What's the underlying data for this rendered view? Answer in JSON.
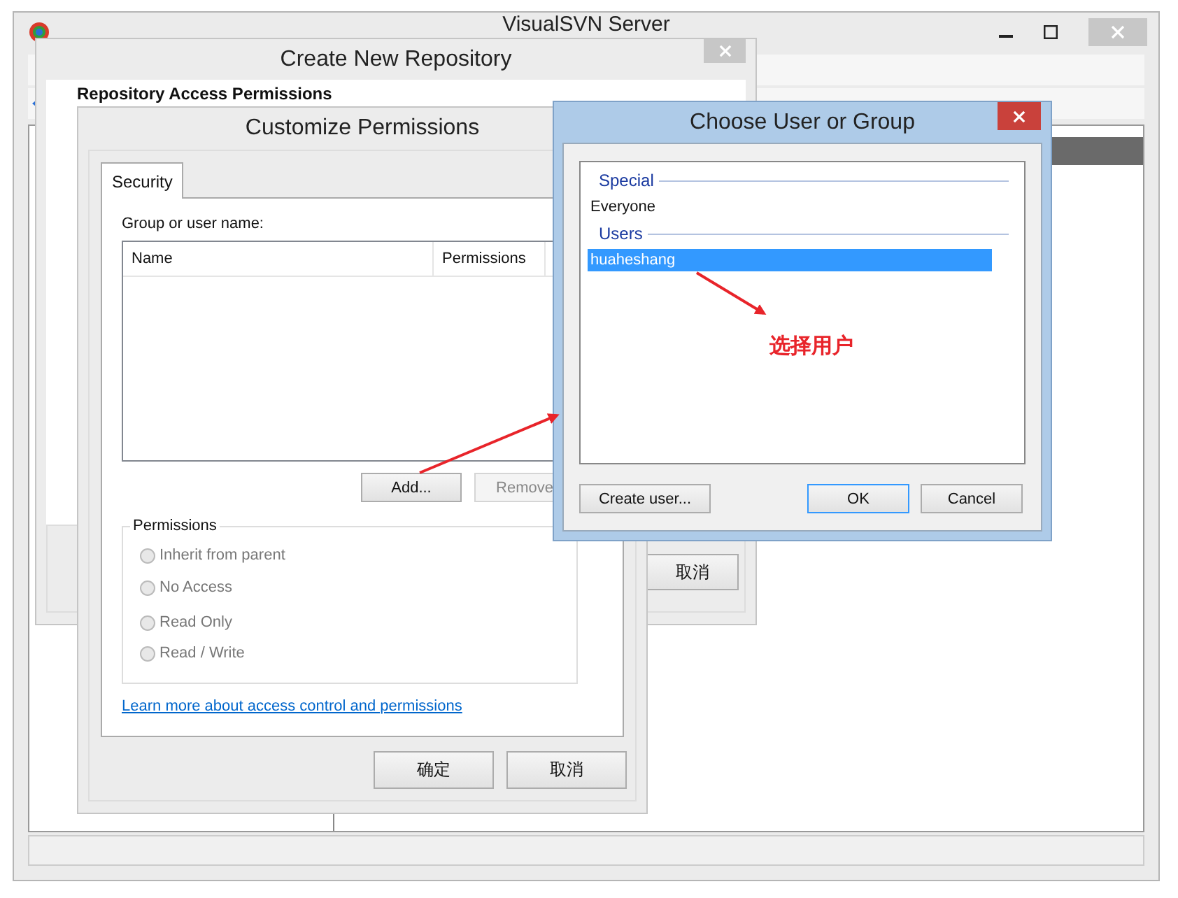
{
  "main_window": {
    "title": "VisualSVN Server"
  },
  "create_dialog": {
    "title": "Create New Repository",
    "heading": "Repository Access Permissions",
    "buttons": [
      "取消"
    ]
  },
  "permissions_dialog": {
    "title": "Customize Permissions",
    "tabs": [
      {
        "label": "Security",
        "selected": true
      }
    ],
    "list_label": "Group or user name:",
    "columns": [
      "Name",
      "Permissions"
    ],
    "list_buttons": [
      {
        "label": "Add...",
        "disabled": false
      },
      {
        "label": "Remove",
        "disabled": true
      }
    ],
    "group_title": "Permissions",
    "options": [
      {
        "label": "Inherit from parent",
        "selected": false,
        "disabled": true
      },
      {
        "label": "No Access",
        "selected": false,
        "disabled": true
      },
      {
        "label": "Read Only",
        "selected": false,
        "disabled": true
      },
      {
        "label": "Read / Write",
        "selected": false,
        "disabled": true
      }
    ],
    "link": "Learn more about access control and permissions",
    "buttons": [
      "确定",
      "取消"
    ]
  },
  "choose_dialog": {
    "title": "Choose User or Group",
    "groups": [
      {
        "header": "Special",
        "members": [
          {
            "name": "Everyone",
            "selected": false
          }
        ]
      },
      {
        "header": "Users",
        "members": [
          {
            "name": "huaheshang",
            "selected": true
          }
        ]
      }
    ],
    "buttons": [
      {
        "label": "Create user...",
        "default": false
      },
      {
        "label": "OK",
        "default": true
      },
      {
        "label": "Cancel",
        "default": false
      }
    ]
  },
  "annotation": {
    "text": "选择用户"
  }
}
